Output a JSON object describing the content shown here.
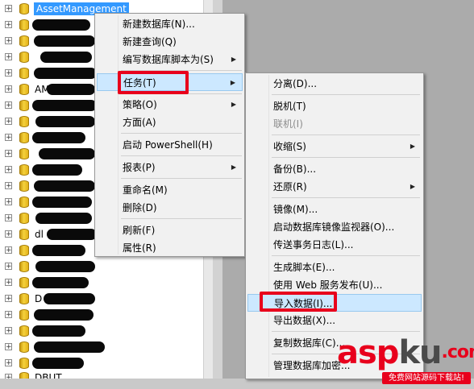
{
  "tree": {
    "selected_label": "AssetManagement",
    "expander_glyph": "+",
    "partial_labels": [
      "AM",
      "dl",
      "D",
      "DBUT"
    ]
  },
  "context_menu": {
    "items": [
      {
        "label": "新建数据库(N)...",
        "has_submenu": false
      },
      {
        "label": "新建查询(Q)",
        "has_submenu": false
      },
      {
        "label": "编写数据库脚本为(S)",
        "has_submenu": true
      },
      {
        "label": "任务(T)",
        "has_submenu": true,
        "highlighted": true
      },
      {
        "label": "策略(O)",
        "has_submenu": true
      },
      {
        "label": "方面(A)",
        "has_submenu": false
      },
      {
        "label": "启动 PowerShell(H)",
        "has_submenu": false
      },
      {
        "label": "报表(P)",
        "has_submenu": true
      },
      {
        "label": "重命名(M)",
        "has_submenu": false
      },
      {
        "label": "删除(D)",
        "has_submenu": false
      },
      {
        "label": "刷新(F)",
        "has_submenu": false
      },
      {
        "label": "属性(R)",
        "has_submenu": false
      }
    ]
  },
  "tasks_submenu": {
    "items": [
      {
        "label": "分离(D)...",
        "enabled": true
      },
      {
        "label": "脱机(T)",
        "enabled": true
      },
      {
        "label": "联机(I)",
        "enabled": false
      },
      {
        "label": "收缩(S)",
        "enabled": true,
        "has_submenu": true
      },
      {
        "label": "备份(B)...",
        "enabled": true
      },
      {
        "label": "还原(R)",
        "enabled": true,
        "has_submenu": true
      },
      {
        "label": "镜像(M)...",
        "enabled": true
      },
      {
        "label": "启动数据库镜像监视器(O)...",
        "enabled": true
      },
      {
        "label": "传送事务日志(L)...",
        "enabled": true
      },
      {
        "label": "生成脚本(E)...",
        "enabled": true
      },
      {
        "label": "使用 Web 服务发布(U)...",
        "enabled": true
      },
      {
        "label": "导入数据(I)...",
        "enabled": true,
        "highlighted": true
      },
      {
        "label": "导出数据(X)...",
        "enabled": true
      },
      {
        "label": "复制数据库(C)...",
        "enabled": true
      },
      {
        "label": "管理数据库加密...",
        "enabled": true
      }
    ]
  },
  "watermark": {
    "logo_asp": "asp",
    "logo_ku": "ku",
    "logo_suffix": ".com",
    "tagline": "免费网站源码下载站!"
  },
  "colors": {
    "selection": "#3399ff",
    "menu_highlight": "#cce8ff",
    "annotation_red": "#e8001c",
    "database_icon": "#f5d23c"
  }
}
